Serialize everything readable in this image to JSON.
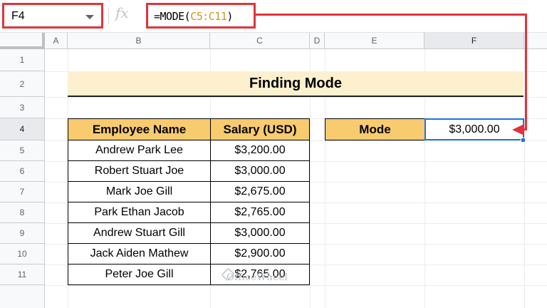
{
  "formula_bar": {
    "cell_ref": "F4",
    "fx_label": "fx",
    "formula_prefix": "=MODE(",
    "formula_range": "C5:C11",
    "formula_suffix": ")"
  },
  "columns": [
    "A",
    "B",
    "C",
    "D",
    "E",
    "F"
  ],
  "rows": [
    "1",
    "2",
    "3",
    "4",
    "5",
    "6",
    "7",
    "8",
    "9",
    "10",
    "11"
  ],
  "sheet": {
    "title": "Finding Mode",
    "table_headers": [
      "Employee Name",
      "Salary (USD)"
    ],
    "employees": [
      {
        "name": "Andrew Park Lee",
        "salary": "$3,200.00"
      },
      {
        "name": "Robert Stuart Joe",
        "salary": "$3,000.00"
      },
      {
        "name": "Mark Joe Gill",
        "salary": "$2,675.00"
      },
      {
        "name": "Park Ethan Jacob",
        "salary": "$2,765.00"
      },
      {
        "name": "Andrew Stuart Gill",
        "salary": "$3,000.00"
      },
      {
        "name": "Jack Aiden Mathew",
        "salary": "$2,900.00"
      },
      {
        "name": "Peter Joe Gill",
        "salary": "$2,765.00"
      }
    ],
    "mode_label": "Mode",
    "mode_value": "$3,000.00"
  },
  "watermark": "OfficeWheel",
  "colors": {
    "highlight_red": "#e0343a",
    "header_fill": "#f8cb6e",
    "title_fill": "#fdf0cf",
    "selection_blue": "#1a73e8"
  }
}
